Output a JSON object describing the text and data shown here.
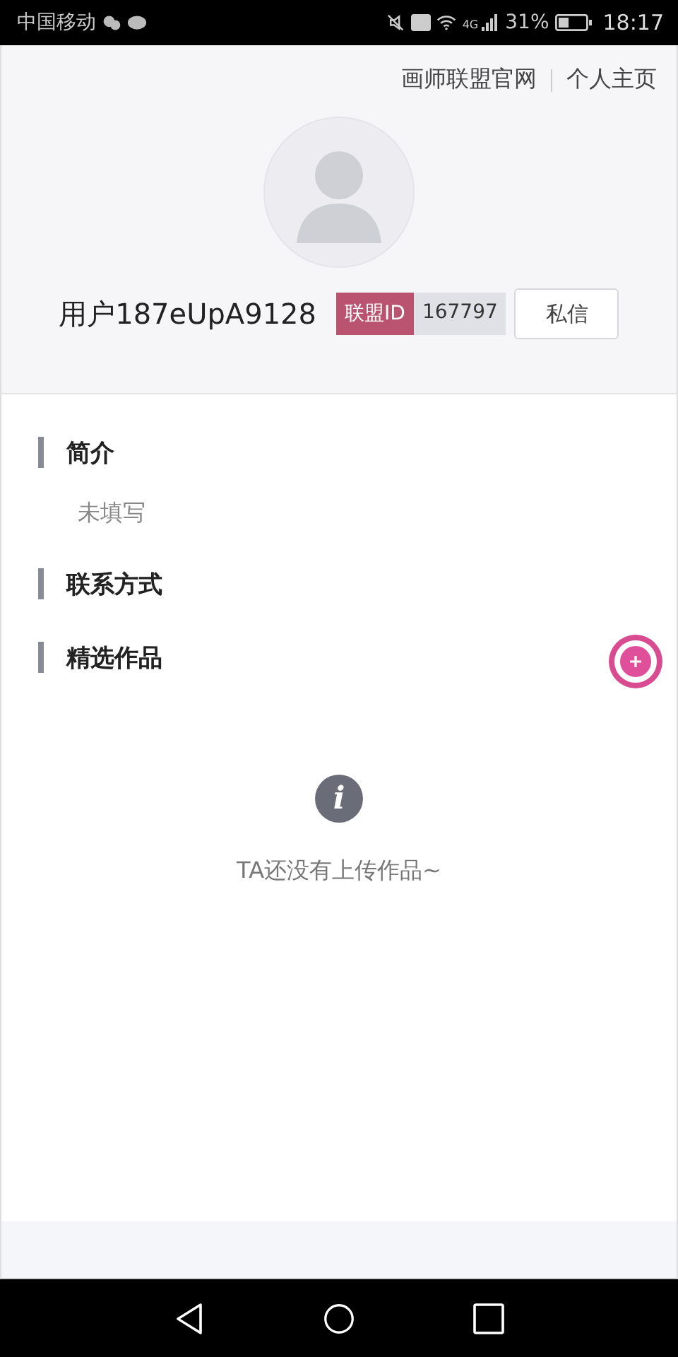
{
  "status_bar": {
    "carrier": "中国移动",
    "network": "4G",
    "battery": "31%",
    "time": "18:17"
  },
  "header_links": [
    {
      "label": "画师联盟官网"
    },
    {
      "label": "个人主页"
    }
  ],
  "profile": {
    "username": "用户187eUpA9128",
    "id_label": "联盟ID",
    "id_value": "167797",
    "message_button": "私信"
  },
  "sections": [
    {
      "title": "简介",
      "text": "未填写"
    },
    {
      "title": "联系方式"
    },
    {
      "title": "精选作品"
    }
  ],
  "empty_state": {
    "icon": "i",
    "text": "TA还没有上传作品~"
  }
}
